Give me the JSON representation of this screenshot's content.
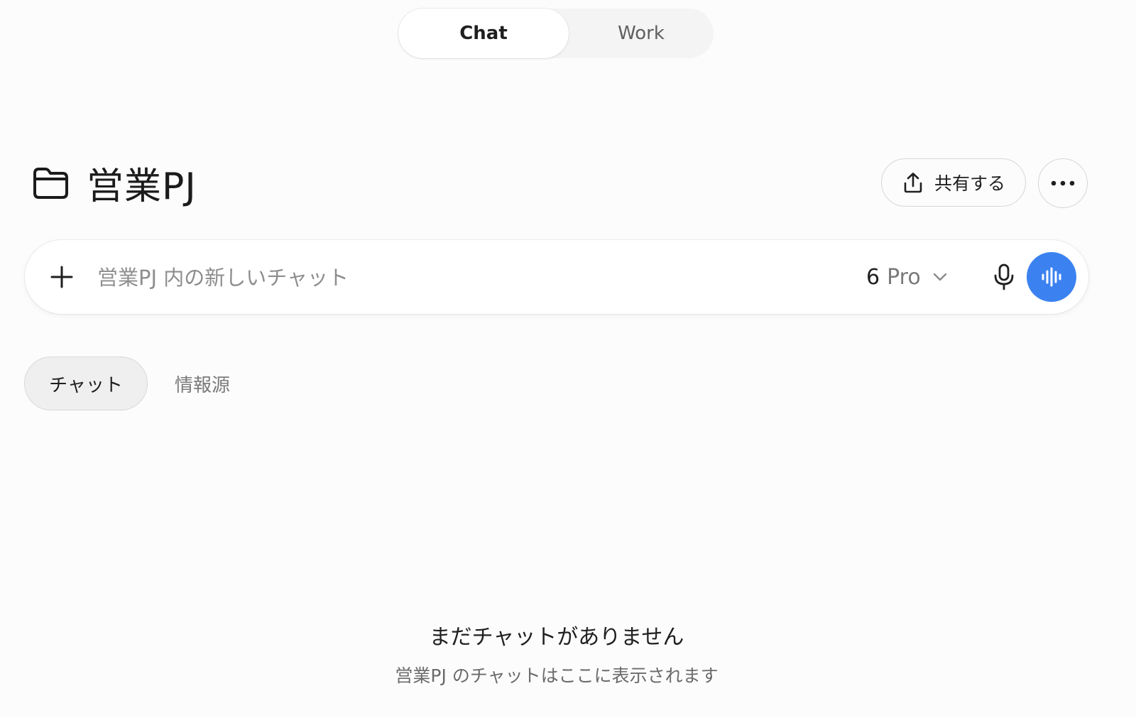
{
  "mode_switch": {
    "tabs": [
      {
        "label": "Chat",
        "active": true
      },
      {
        "label": "Work",
        "active": false
      }
    ]
  },
  "project": {
    "icon": "folder-icon",
    "title": "営業PJ"
  },
  "actions": {
    "share_label": "共有する",
    "share_icon": "upload-icon",
    "more_icon": "ellipsis-icon"
  },
  "composer": {
    "add_icon": "plus-icon",
    "placeholder": "営業PJ 内の新しいチャット",
    "value": "",
    "model_version": "6",
    "model_name": "Pro",
    "model_dropdown_icon": "chevron-down-icon",
    "mic_icon": "microphone-icon",
    "voice_icon": "voice-waveform-icon",
    "accent_color": "#3b82f0"
  },
  "tabs": {
    "chats_label": "チャット",
    "sources_label": "情報源",
    "active": "chats"
  },
  "empty_state": {
    "title": "まだチャットがありません",
    "subtitle": "営業PJ のチャットはここに表示されます"
  }
}
